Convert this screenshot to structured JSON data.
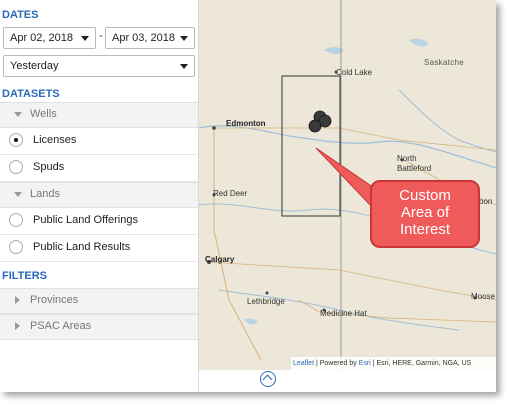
{
  "sidebar": {
    "dates_title": "DATES",
    "date_from": "Apr 02, 2018",
    "date_sep": "-",
    "date_to": "Apr 03, 2018",
    "range_preset": "Yesterday",
    "datasets_title": "DATASETS",
    "wells_group": "Wells",
    "wells_items": [
      "Licenses",
      "Spuds"
    ],
    "wells_selected": "Licenses",
    "lands_group": "Lands",
    "lands_items": [
      "Public Land Offerings",
      "Public Land Results"
    ],
    "filters_title": "FILTERS",
    "filter_groups": [
      "Provinces",
      "PSAC Areas"
    ]
  },
  "map": {
    "cities": {
      "cold_lake": "Cold Lake",
      "saskatchewan": "Saskatche",
      "edmonton": "Edmonton",
      "north_battleford_1": "North",
      "north_battleford_2": "Battleford",
      "red_deer": "Red Deer",
      "saskatoon_partial": "oon",
      "calgary": "Calgary",
      "moose": "Moose",
      "medicine_hat": "Medicine Hat",
      "lethbridge": "Lethbridge"
    },
    "attribution": {
      "leaflet": "Leaflet",
      "powered_by": "| Powered by",
      "esri": "Esri",
      "sources": "| Esri, HERE, Garmin, NGA, US"
    },
    "wells_count_shown": 3
  },
  "callout": {
    "line1": "Custom",
    "line2": "Area of",
    "line3": "Interest"
  },
  "colors": {
    "accent": "#2a6ab8",
    "callout": "#ef5b5b",
    "map_bg": "#ece7d8"
  }
}
